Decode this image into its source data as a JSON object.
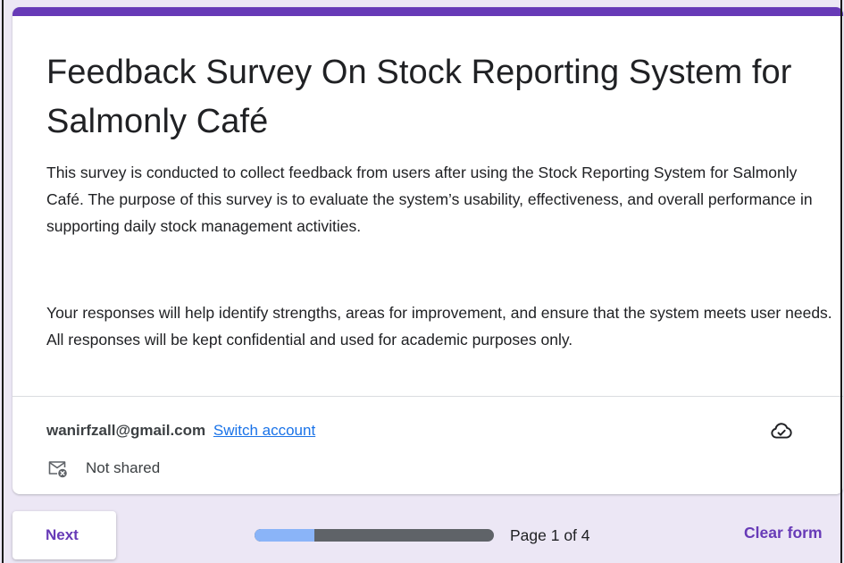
{
  "form": {
    "title": "Feedback Survey On Stock Reporting System for Salmonly Café",
    "description_paragraph_1": "This survey is conducted to collect feedback from users after using the Stock Reporting System for Salmonly Café. The purpose of this survey is to evaluate the system’s usability, effectiveness, and overall performance in supporting daily stock management activities.",
    "description_paragraph_2": "Your responses will help identify strengths, areas for improvement, and ensure that the system meets user needs. All responses will be kept confidential and used for academic purposes only."
  },
  "account": {
    "email": "wanirfzall@gmail.com",
    "switch_label": "Switch account",
    "shared_status": "Not shared",
    "cloud_icon": "cloud-saved-icon",
    "mail_icon": "mail-not-shared-icon"
  },
  "footer": {
    "next_label": "Next",
    "page_label": "Page 1 of 4",
    "progress_fraction": 0.25,
    "clear_label": "Clear form"
  },
  "colors": {
    "accent": "#673ab7",
    "link": "#1a73e8",
    "background": "#ece7f5",
    "progress_fill": "#8ab4f8",
    "progress_track": "#5f6368"
  }
}
